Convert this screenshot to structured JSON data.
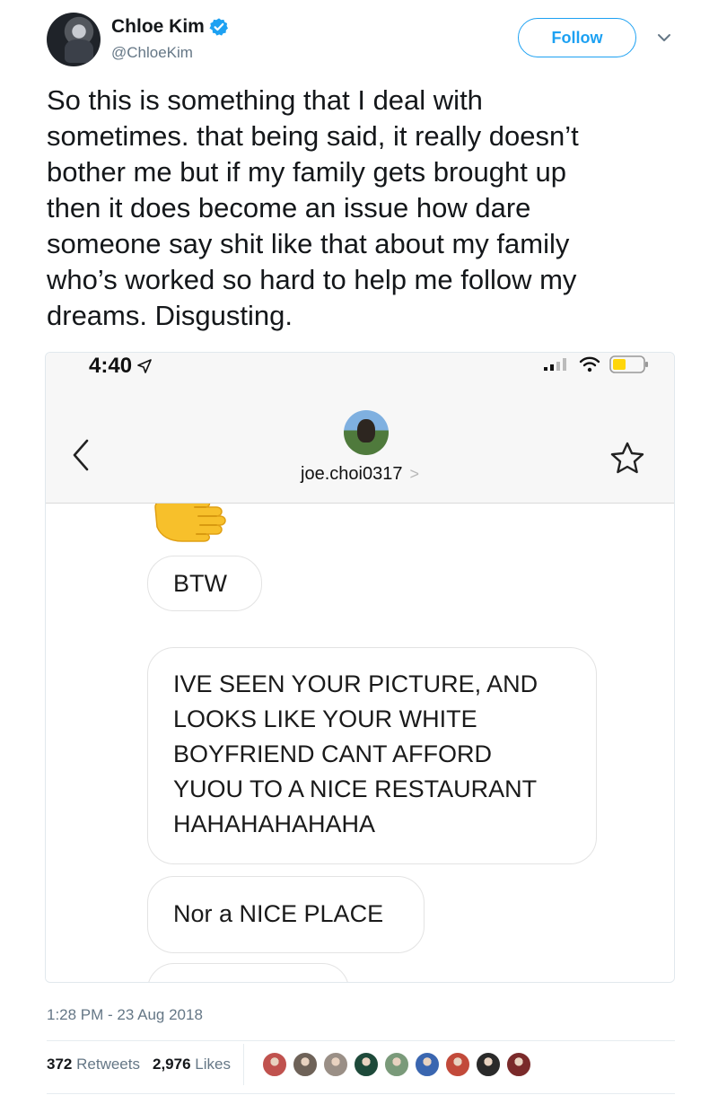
{
  "tweet": {
    "author_name": "Chloe Kim",
    "author_handle": "@ChloeKim",
    "follow_label": "Follow",
    "text": "So this is something that I deal with\nsometimes. that being said, it really doesn’t\nbother me but if my family gets brought up\nthen it does become an issue how dare\nsomeone say shit like that about my family\nwho’s worked so hard to help me follow my\ndreams. Disgusting.",
    "timestamp": "1:28 PM - 23 Aug 2018",
    "retweets_count": "372",
    "retweets_label": "Retweets",
    "likes_count": "2,976",
    "likes_label": "Likes",
    "liker_colors": [
      "#c0524e",
      "#6e6258",
      "#9a8f86",
      "#1e4a3a",
      "#7a9a7a",
      "#3a66b0",
      "#c24a3a",
      "#2a2a2a",
      "#7a2a2a"
    ],
    "icons": [
      "verified-badge-icon",
      "chevron-down-icon"
    ]
  },
  "media": {
    "status_time": "4:40",
    "contact_name": "joe.choi0317",
    "contact_chevron": ">",
    "messages": [
      "BTW",
      "IVE SEEN YOUR PICTURE, AND\nLOOKS LIKE YOUR WHITE\nBOYFRIEND CANT AFFORD\nYUOU TO A NICE RESTAURANT\nHAHAHAHAHAHA",
      "Nor a NICE PLACE"
    ],
    "icons": [
      "location-arrow-icon",
      "signal-icon",
      "wifi-icon",
      "battery-icon",
      "back-chevron-icon",
      "star-icon",
      "thumbs-up-emoji-icon"
    ]
  },
  "colors": {
    "twitter_blue": "#1da1f2",
    "secondary_text": "#657786",
    "battery_fill": "#ffd60a",
    "emoji_yellow": "#f7c02b"
  }
}
